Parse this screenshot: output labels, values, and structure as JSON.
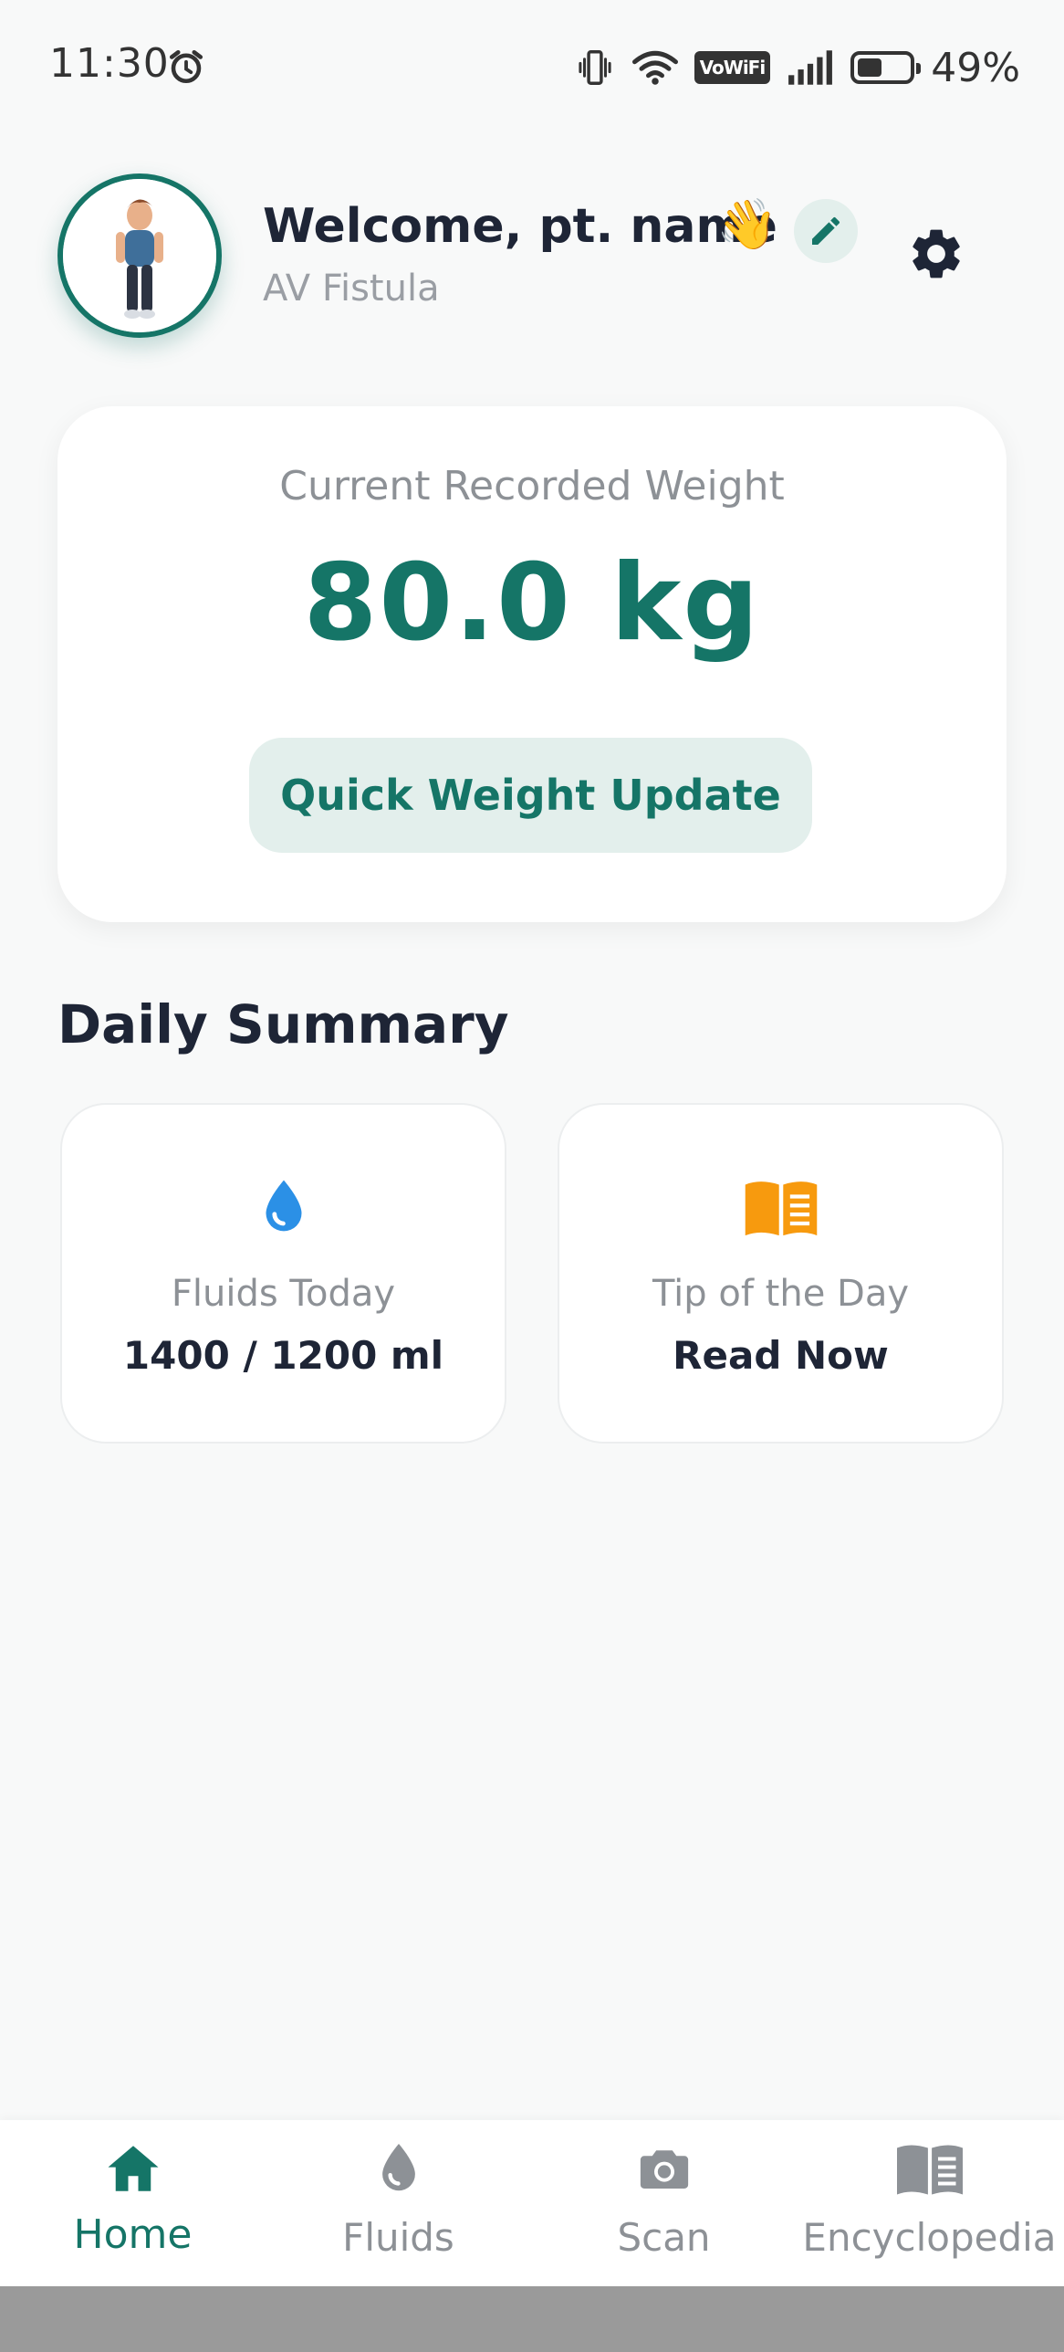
{
  "status_bar": {
    "time": "11:30",
    "vowifi_label": "VoWiFi",
    "battery_percent_text": "49%",
    "battery_level": 0.49,
    "icons": [
      "alarm-icon",
      "vibrate-icon",
      "wifi-icon",
      "vowifi-icon",
      "signal-icon",
      "battery-icon"
    ]
  },
  "header": {
    "welcome_text": "Welcome, pt. name",
    "wave_emoji": "👋",
    "subtitle": "AV Fistula",
    "icons": [
      "avatar",
      "edit-icon",
      "gear-icon"
    ]
  },
  "weight_card": {
    "label": "Current Recorded Weight",
    "value": "80.0 kg",
    "button_label": "Quick Weight Update"
  },
  "daily_summary": {
    "title": "Daily Summary",
    "cards": [
      {
        "icon": "water-drop-icon",
        "label": "Fluids Today",
        "value": "1400 / 1200 ml"
      },
      {
        "icon": "open-book-icon",
        "label": "Tip of the Day",
        "value": "Read Now"
      }
    ]
  },
  "bottom_nav": {
    "items": [
      {
        "label": "Home",
        "icon": "home-icon",
        "active": true
      },
      {
        "label": "Fluids",
        "icon": "drop-icon",
        "active": false
      },
      {
        "label": "Scan",
        "icon": "camera-icon",
        "active": false
      },
      {
        "label": "Encyclopedia",
        "icon": "book-icon",
        "active": false
      }
    ]
  },
  "colors": {
    "primary": "#157567",
    "primary_light": "#e3efec",
    "background": "#f8f9f9",
    "text_dark": "#1e2536",
    "text_muted": "#8d9196",
    "water_blue": "#2b90e6",
    "book_orange": "#f79a0e"
  }
}
